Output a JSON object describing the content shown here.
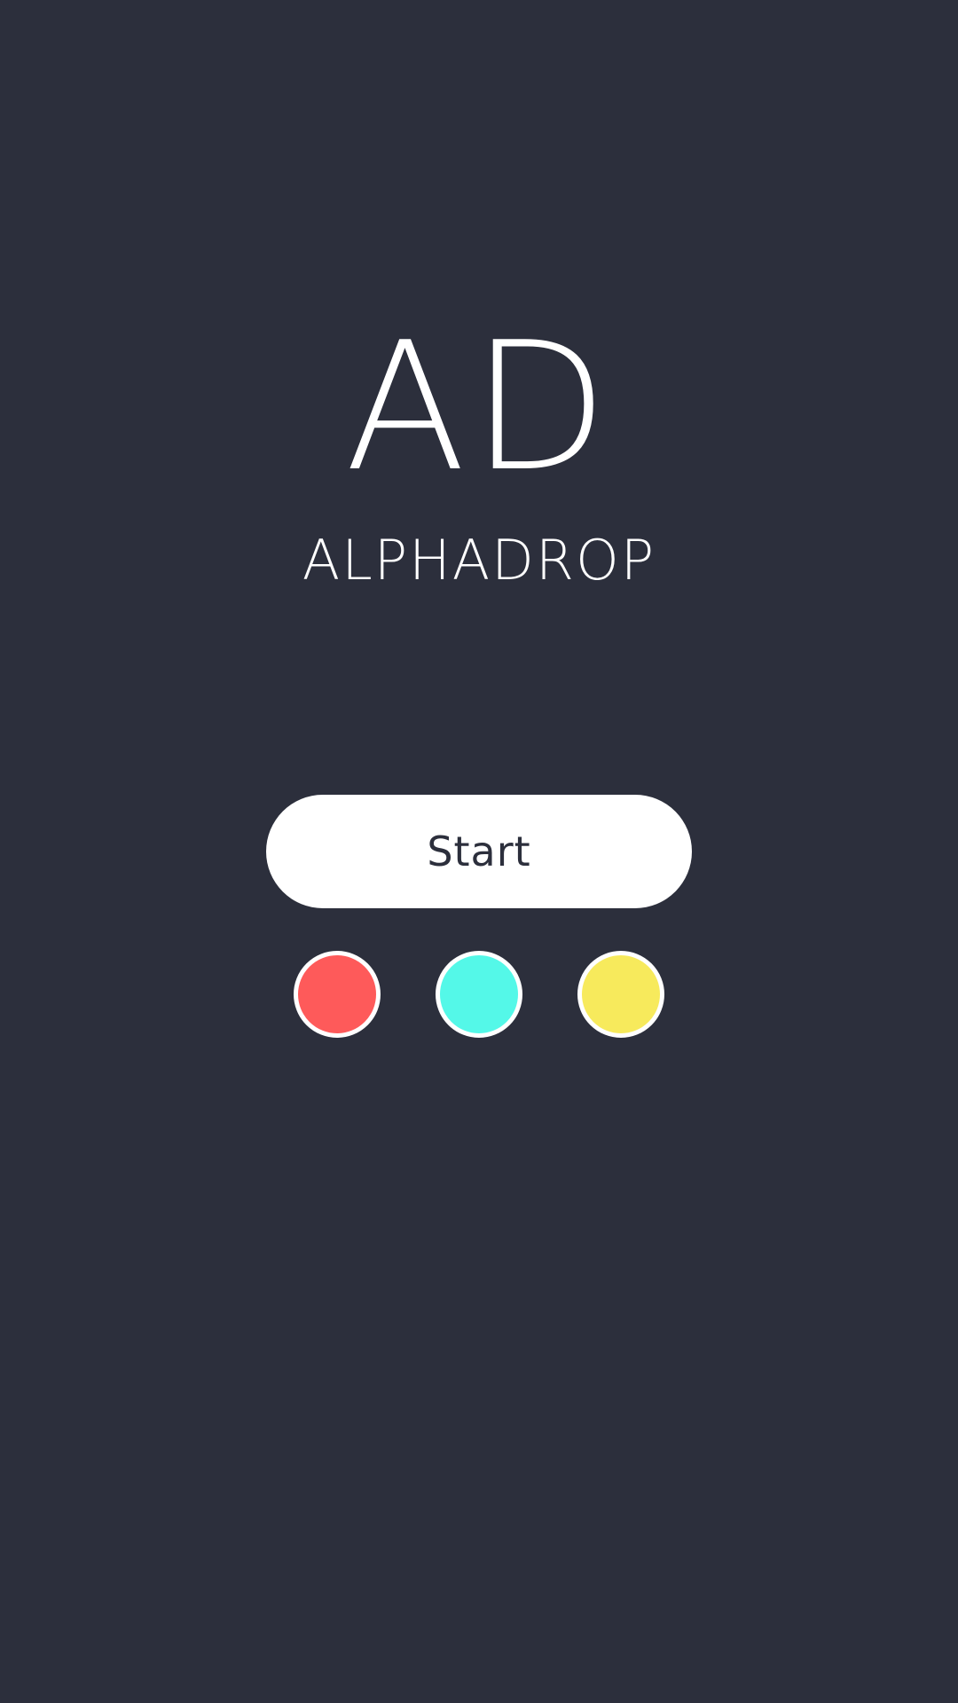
{
  "logo": {
    "text": "AD"
  },
  "app": {
    "name": "ALPHADROP"
  },
  "start_button": {
    "label": "Start"
  },
  "color_options": [
    {
      "name": "red",
      "color": "#fe5a5a"
    },
    {
      "name": "cyan",
      "color": "#54f8e8"
    },
    {
      "name": "yellow",
      "color": "#f7ea5c"
    }
  ],
  "colors": {
    "background": "#2c2f3c",
    "foreground": "#ffffff"
  }
}
